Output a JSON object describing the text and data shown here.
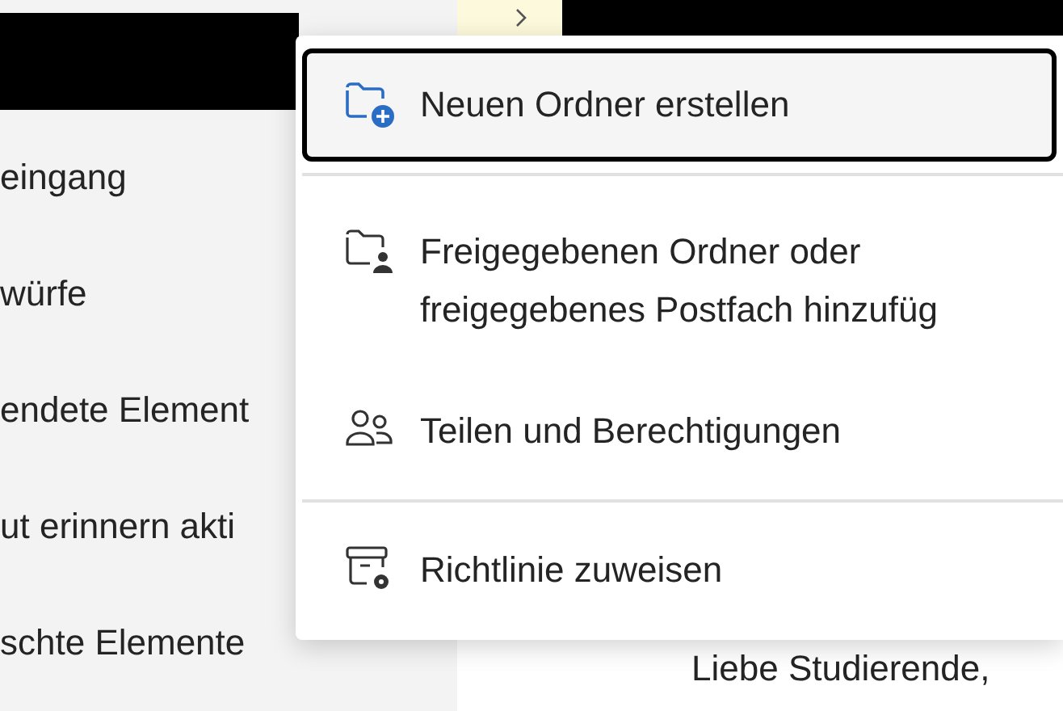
{
  "sidebar": {
    "items": [
      {
        "label": "eingang"
      },
      {
        "label": "würfe"
      },
      {
        "label": "endete Element"
      },
      {
        "label": "ut erinnern akti"
      },
      {
        "label": "schte Elemente"
      }
    ]
  },
  "reading_pane": {
    "greeting": "Liebe Studierende,"
  },
  "context_menu": {
    "items": [
      {
        "kind": "new-folder",
        "lines": [
          "Neuen Ordner erstellen"
        ],
        "focused": true
      },
      {
        "kind": "divider"
      },
      {
        "kind": "shared-folder",
        "lines": [
          "Freigegebenen Ordner oder",
          "freigegebenes Postfach hinzufüg"
        ],
        "focused": false
      },
      {
        "kind": "sharing",
        "lines": [
          "Teilen und Berechtigungen"
        ],
        "focused": false
      },
      {
        "kind": "divider"
      },
      {
        "kind": "policy",
        "lines": [
          "Richtlinie zuweisen"
        ],
        "focused": false
      }
    ]
  }
}
